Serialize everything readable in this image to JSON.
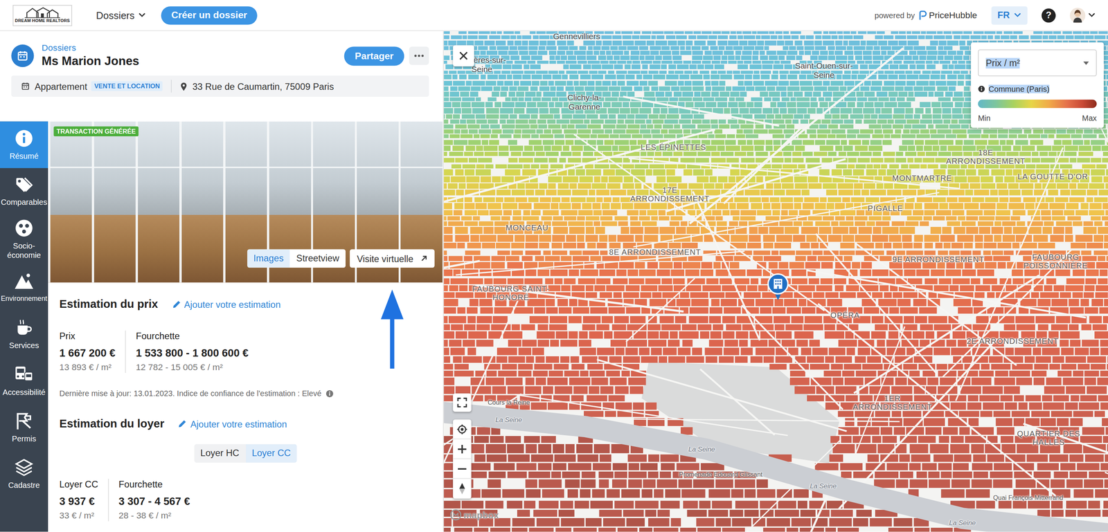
{
  "topbar": {
    "logo": "DREAM HOME REALTORS",
    "menu": "Dossiers",
    "create_button": "Créer un dossier",
    "powered_by": "powered by",
    "brand": "PriceHubble",
    "language": "FR",
    "help": "?"
  },
  "dossier": {
    "breadcrumb": "Dossiers",
    "title": "Ms Marion Jones",
    "share_button": "Partager",
    "property_type": "Appartement",
    "badge": "VENTE ET LOCATION",
    "address": "33 Rue de Caumartin, 75009 Paris"
  },
  "nav": [
    {
      "label": "Résumé",
      "selected": true
    },
    {
      "label": "Comparables",
      "selected": false
    },
    {
      "label": "Socio-économie",
      "selected": false
    },
    {
      "label": "Environnement",
      "selected": false
    },
    {
      "label": "Services",
      "selected": false
    },
    {
      "label": "Accessibilité",
      "selected": false
    },
    {
      "label": "Permis",
      "selected": false
    },
    {
      "label": "Cadastre",
      "selected": false
    }
  ],
  "photo": {
    "badge": "TRANSACTION GÉNÉRÉE",
    "tabs": [
      {
        "label": "Images",
        "selected": true
      },
      {
        "label": "Streetview",
        "selected": false
      }
    ],
    "virtual_tour": "Visite virtuelle"
  },
  "price": {
    "title": "Estimation du prix",
    "add": "Ajouter votre estimation",
    "columns": [
      {
        "label": "Prix",
        "value": "1 667 200 €",
        "sub": "13 893 € / m²"
      },
      {
        "label": "Fourchette",
        "value": "1 533 800 - 1 800 600 €",
        "sub": "12 782 - 15 005 € / m²"
      }
    ],
    "footnote": "Dernière mise à jour: 13.01.2023. Indice de confiance de l'estimation : Elevé"
  },
  "rent": {
    "title": "Estimation du loyer",
    "add": "Ajouter votre estimation",
    "toggle": [
      {
        "label": "Loyer HC",
        "selected": false
      },
      {
        "label": "Loyer CC",
        "selected": true
      }
    ],
    "columns": [
      {
        "label": "Loyer CC",
        "value": "3 937 €",
        "sub": "33 € / m²"
      },
      {
        "label": "Fourchette",
        "value": "3 307 - 4 567 €",
        "sub": "28 - 38 € / m²"
      }
    ]
  },
  "map": {
    "legend": {
      "metric": "Prix / m²",
      "scope": "Commune (Paris)",
      "min": "Min",
      "max": "Max",
      "text_selected": true
    },
    "attribution": "mapbox",
    "labels": [
      {
        "text": "Gennevilliers",
        "kind": "town"
      },
      {
        "text": "Asnières-sur-Seine",
        "kind": "town"
      },
      {
        "text": "Clichy-la-Garenne",
        "kind": "town"
      },
      {
        "text": "Saint-Ouen-sur-Seine",
        "kind": "town"
      },
      {
        "text": "LES ÉPINETTES",
        "kind": "district"
      },
      {
        "text": "17E ARRONDISSEMENT",
        "kind": "district"
      },
      {
        "text": "18E ARRONDISSEMENT",
        "kind": "district"
      },
      {
        "text": "MONTMARTRE",
        "kind": "district"
      },
      {
        "text": "LA GOUTTE D'OR",
        "kind": "district"
      },
      {
        "text": "PIGALLE",
        "kind": "district"
      },
      {
        "text": "MONCEAU",
        "kind": "district"
      },
      {
        "text": "8E ARRONDISSEMENT",
        "kind": "district"
      },
      {
        "text": "9E ARRONDISSEMENT",
        "kind": "district"
      },
      {
        "text": "FAUBOURG POISSONNIÈRE",
        "kind": "district"
      },
      {
        "text": "FAUBOURG SAINT-HONORÉ",
        "kind": "district"
      },
      {
        "text": "OPÉRA",
        "kind": "district"
      },
      {
        "text": "2E ARRONDISSEMENT",
        "kind": "district"
      },
      {
        "text": "1ER ARRONDISSEMENT",
        "kind": "district"
      },
      {
        "text": "QUARTIER DES HALLES",
        "kind": "district"
      },
      {
        "text": "Cours la Reine",
        "kind": "street"
      },
      {
        "text": "La Seine",
        "kind": "water"
      },
      {
        "text": "La Seine",
        "kind": "water"
      },
      {
        "text": "La Seine",
        "kind": "water"
      },
      {
        "text": "La Seine",
        "kind": "water"
      },
      {
        "text": "Promenade Edouard Glissant",
        "kind": "street"
      },
      {
        "text": "Quai François Mitterrand",
        "kind": "street"
      }
    ]
  }
}
